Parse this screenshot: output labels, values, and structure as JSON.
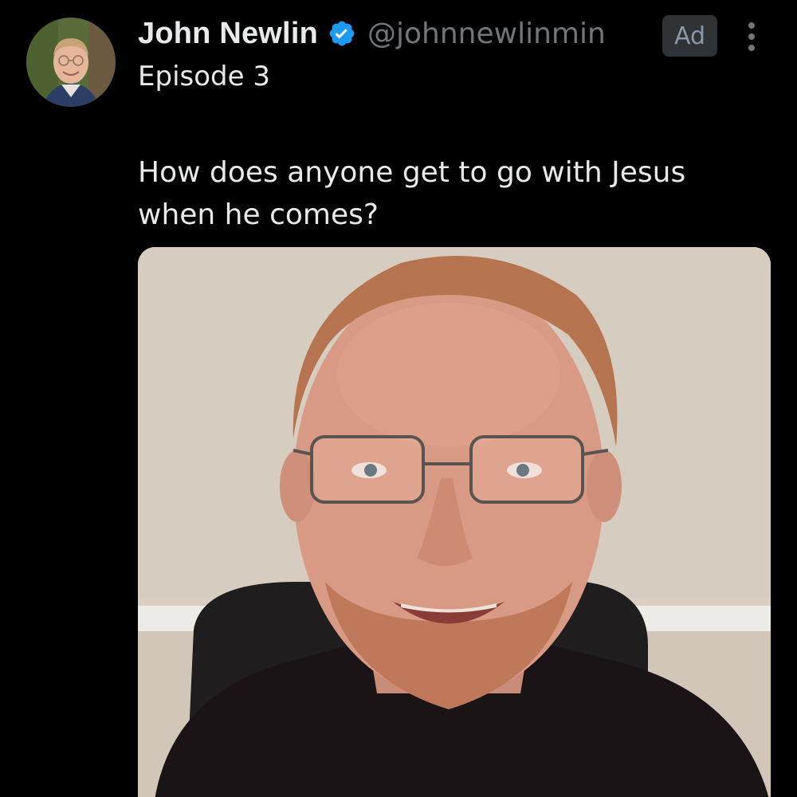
{
  "post": {
    "author": {
      "display_name": "John Newlin",
      "handle": "@johnnewlinmin",
      "verified": true,
      "verified_color": "#1d9bf0",
      "avatar_icon": "avatar-photo"
    },
    "badge": "Ad",
    "more_icon": "more-vertical-icon",
    "subtitle": "Episode 3",
    "text": "How does anyone get to go with Jesus\nwhen he comes?",
    "media": {
      "type": "video",
      "icon": "video-thumbnail"
    }
  },
  "theme": {
    "background": "#000000",
    "text_primary": "#e7e9ea",
    "text_secondary": "#71767b",
    "badge_bg": "#2f3336"
  }
}
